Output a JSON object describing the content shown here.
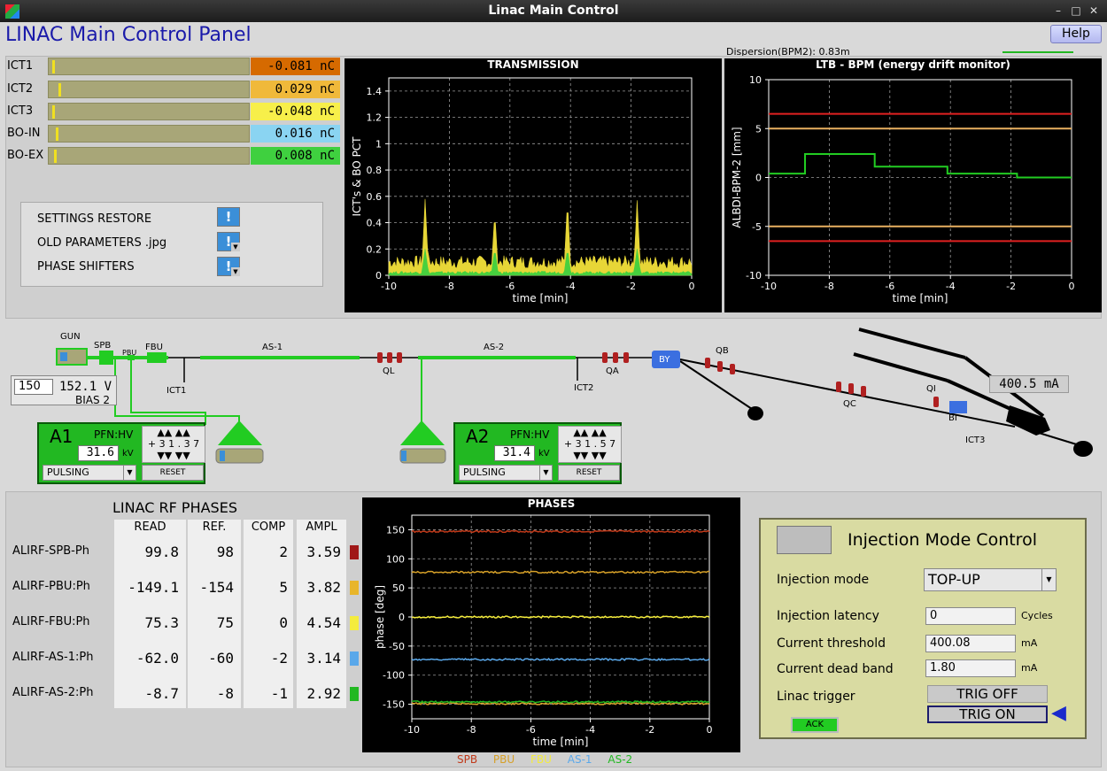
{
  "window": {
    "title": "Linac Main Control"
  },
  "header": {
    "title": "LINAC Main Control Panel",
    "help_label": "Help",
    "dispersion": "Dispersion(BPM2): 0.83m"
  },
  "icons": {
    "app": "app-icon",
    "minimize": "minimize-icon",
    "maximize": "maximize-icon",
    "close": "close-icon",
    "restore": "exclamation-icon",
    "ack_indicator": "triangle-left-icon"
  },
  "charges": [
    {
      "label": "ICT1",
      "value": "-0.081 nC",
      "color": "#d66a00",
      "level": 0.0
    },
    {
      "label": "ICT2",
      "value": "0.029 nC",
      "color": "#f0b93a",
      "level": 0.03
    },
    {
      "label": "ICT3",
      "value": "-0.048 nC",
      "color": "#f7ef4a",
      "level": 0.0
    },
    {
      "label": "BO-IN",
      "value": "0.016 nC",
      "color": "#8ad4f2",
      "level": 0.016
    },
    {
      "label": "BO-EX",
      "value": "0.008 nC",
      "color": "#3fd03f",
      "level": 0.008
    }
  ],
  "settings": [
    {
      "label": "SETTINGS RESTORE",
      "dropdown": false
    },
    {
      "label": "OLD PARAMETERS .jpg",
      "dropdown": true
    },
    {
      "label": "PHASE SHIFTERS",
      "dropdown": true
    }
  ],
  "beamline": {
    "labels": {
      "gun": "GUN",
      "spb": "SPB",
      "pbu": "PBU",
      "fbu": "FBU",
      "as1": "AS-1",
      "as2": "AS-2",
      "ql": "QL",
      "qa": "QA",
      "by": "BY",
      "qb": "QB",
      "qc": "QC",
      "qi": "QI",
      "bi": "BI",
      "ict1": "ICT1",
      "ict2": "ICT2",
      "ict3": "ICT3"
    },
    "gun_setpoint": "150",
    "gun_voltage": "152.1 V",
    "bias": "BIAS 2",
    "beam_current": "400.5 mA"
  },
  "amplifiers": [
    {
      "name": "A1",
      "pfn": "PFN:HV",
      "kv": "31.6",
      "kv_unit": "kV",
      "digits": "+ 3 1 . 3 7",
      "mode": "PULSING",
      "reset": "RESET"
    },
    {
      "name": "A2",
      "pfn": "PFN:HV",
      "kv": "31.4",
      "kv_unit": "kV",
      "digits": "+ 3 1 . 5 7",
      "mode": "PULSING",
      "reset": "RESET"
    }
  ],
  "rf_phases": {
    "title": "LINAC RF PHASES",
    "headers": [
      "READ",
      "REF.",
      "COMP",
      "AMPL"
    ],
    "rows": [
      {
        "name": "ALIRF-SPB-Ph",
        "read": "99.8",
        "ref": "98",
        "comp": "2",
        "ampl": "3.59",
        "color": "#a01818"
      },
      {
        "name": "ALIRF-PBU:Ph",
        "read": "-149.1",
        "ref": "-154",
        "comp": "5",
        "ampl": "3.82",
        "color": "#e8b52a"
      },
      {
        "name": "ALIRF-FBU:Ph",
        "read": "75.3",
        "ref": "75",
        "comp": "0",
        "ampl": "4.54",
        "color": "#f4ec3c"
      },
      {
        "name": "ALIRF-AS-1:Ph",
        "read": "-62.0",
        "ref": "-60",
        "comp": "-2",
        "ampl": "3.14",
        "color": "#5aa8ea"
      },
      {
        "name": "ALIRF-AS-2:Ph",
        "read": "-8.7",
        "ref": "-8",
        "comp": "-1",
        "ampl": "2.92",
        "color": "#22b822"
      }
    ]
  },
  "injection": {
    "title": "Injection Mode Control",
    "mode_label": "Injection mode",
    "mode_value": "TOP-UP",
    "latency_label": "Injection latency",
    "latency_value": "0",
    "latency_unit": "Cycles",
    "threshold_label": "Current threshold",
    "threshold_value": "400.08",
    "threshold_unit": "mA",
    "deadband_label": "Current dead band",
    "deadband_value": "1.80",
    "deadband_unit": "mA",
    "trigger_label": "Linac trigger",
    "trig_off": "TRIG OFF",
    "trig_on": "TRIG ON",
    "ack": "ACK"
  },
  "chart_data": [
    {
      "type": "area",
      "title": "TRANSMISSION",
      "xlabel": "time [min]",
      "ylabel": "ICT's & BO PCT",
      "xlim": [
        -10,
        0
      ],
      "ylim": [
        0,
        1.5
      ],
      "xticks": [
        "-10",
        "-8",
        "-6",
        "-4",
        "-2",
        "0"
      ],
      "yticks": [
        "0",
        "0.2",
        "0.4",
        "0.6",
        "0.8",
        "1",
        "1.2",
        "1.4"
      ],
      "grid": true,
      "series": [
        {
          "color": "#f4e23a",
          "baseline": 0.1,
          "spikes": [
            [
              -8.8,
              0.58
            ],
            [
              -6.5,
              0.48
            ],
            [
              -4.1,
              0.57
            ],
            [
              -1.8,
              0.57
            ]
          ]
        },
        {
          "color": "#3fd03f",
          "baseline": 0.02,
          "spikes": [
            [
              -8.8,
              0.2
            ],
            [
              -6.5,
              0.2
            ],
            [
              -4.1,
              0.2
            ],
            [
              -1.8,
              0.2
            ]
          ]
        }
      ]
    },
    {
      "type": "line",
      "title": "LTB - BPM (energy drift monitor)",
      "xlabel": "time [min]",
      "ylabel": "ALBDI-BPM-2 [mm]",
      "xlim": [
        -10,
        0
      ],
      "ylim": [
        -10,
        10
      ],
      "xticks": [
        "-10",
        "-8",
        "-6",
        "-4",
        "-2",
        "0"
      ],
      "yticks": [
        "-10",
        "-5",
        "0",
        "5",
        "10"
      ],
      "grid": true,
      "hlines": [
        {
          "y": 6.5,
          "color": "#e02020"
        },
        {
          "y": 5.0,
          "color": "#e8b060"
        },
        {
          "y": -5.0,
          "color": "#e8b060"
        },
        {
          "y": -6.5,
          "color": "#e02020"
        }
      ],
      "series": [
        {
          "color": "#22cc22",
          "x": [
            -10,
            -8.8,
            -8.8,
            -6.5,
            -6.5,
            -4.1,
            -4.1,
            -1.8,
            -1.8,
            0
          ],
          "y": [
            0.4,
            0.4,
            2.4,
            2.4,
            1.1,
            1.1,
            0.4,
            0.4,
            0.0,
            0.0
          ]
        }
      ]
    },
    {
      "type": "line",
      "title": "PHASES",
      "xlabel": "time [min]",
      "ylabel": "phase [deg]",
      "xlim": [
        -10,
        0
      ],
      "ylim": [
        -175,
        175
      ],
      "xticks": [
        "-10",
        "-8",
        "-6",
        "-4",
        "-2",
        "0"
      ],
      "yticks": [
        "-150",
        "-100",
        "-50",
        "0",
        "50",
        "100",
        "150"
      ],
      "grid": true,
      "series": [
        {
          "name": "SPB",
          "color": "#c03a1a",
          "value": 147
        },
        {
          "name": "PBU",
          "color": "#d6a028",
          "value": -149
        },
        {
          "name": "FBU",
          "color": "#f4ec3c",
          "value": 0
        },
        {
          "name": "AS-1",
          "color": "#5aa8ea",
          "value": -73
        },
        {
          "name": "AS-2",
          "color": "#22b822",
          "value": -146
        }
      ],
      "extra_line": {
        "color": "#d6a028",
        "value": 77
      }
    }
  ]
}
